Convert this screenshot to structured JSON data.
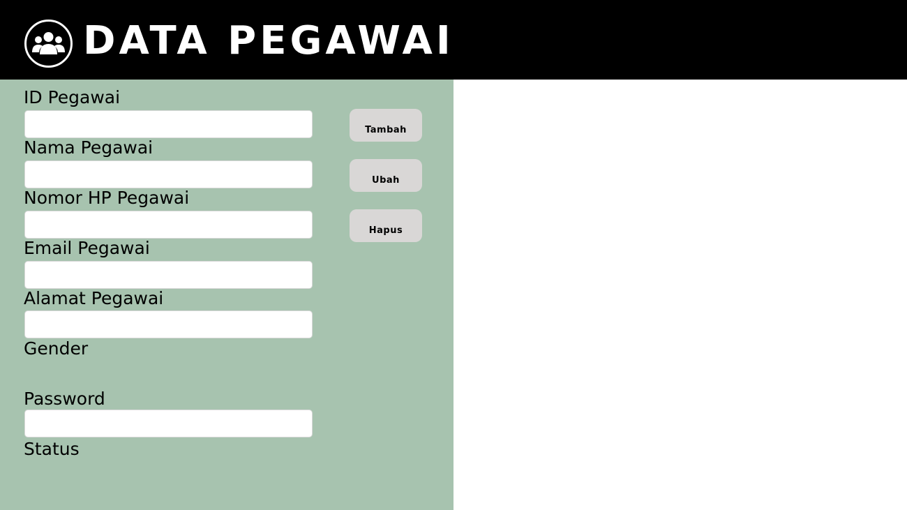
{
  "header": {
    "title": "DATA PEGAWAI",
    "logo_icon": "users-group-icon"
  },
  "form": {
    "fields": [
      {
        "label": "ID Pegawai",
        "value": "",
        "placeholder": ""
      },
      {
        "label": "Nama Pegawai",
        "value": "",
        "placeholder": ""
      },
      {
        "label": "Nomor HP Pegawai",
        "value": "",
        "placeholder": ""
      },
      {
        "label": "Email Pegawai",
        "value": "",
        "placeholder": ""
      },
      {
        "label": "Alamat Pegawai",
        "value": "",
        "placeholder": ""
      },
      {
        "label": "Gender"
      },
      {
        "label": "Password",
        "value": "",
        "placeholder": ""
      },
      {
        "label": "Status"
      }
    ]
  },
  "actions": {
    "tambah": "Tambah",
    "ubah": "Ubah",
    "hapus": "Hapus"
  },
  "colors": {
    "header_bg": "#000000",
    "panel_bg": "#a7c3af",
    "button_bg": "#d9d7d6",
    "input_bg": "#ffffff"
  }
}
